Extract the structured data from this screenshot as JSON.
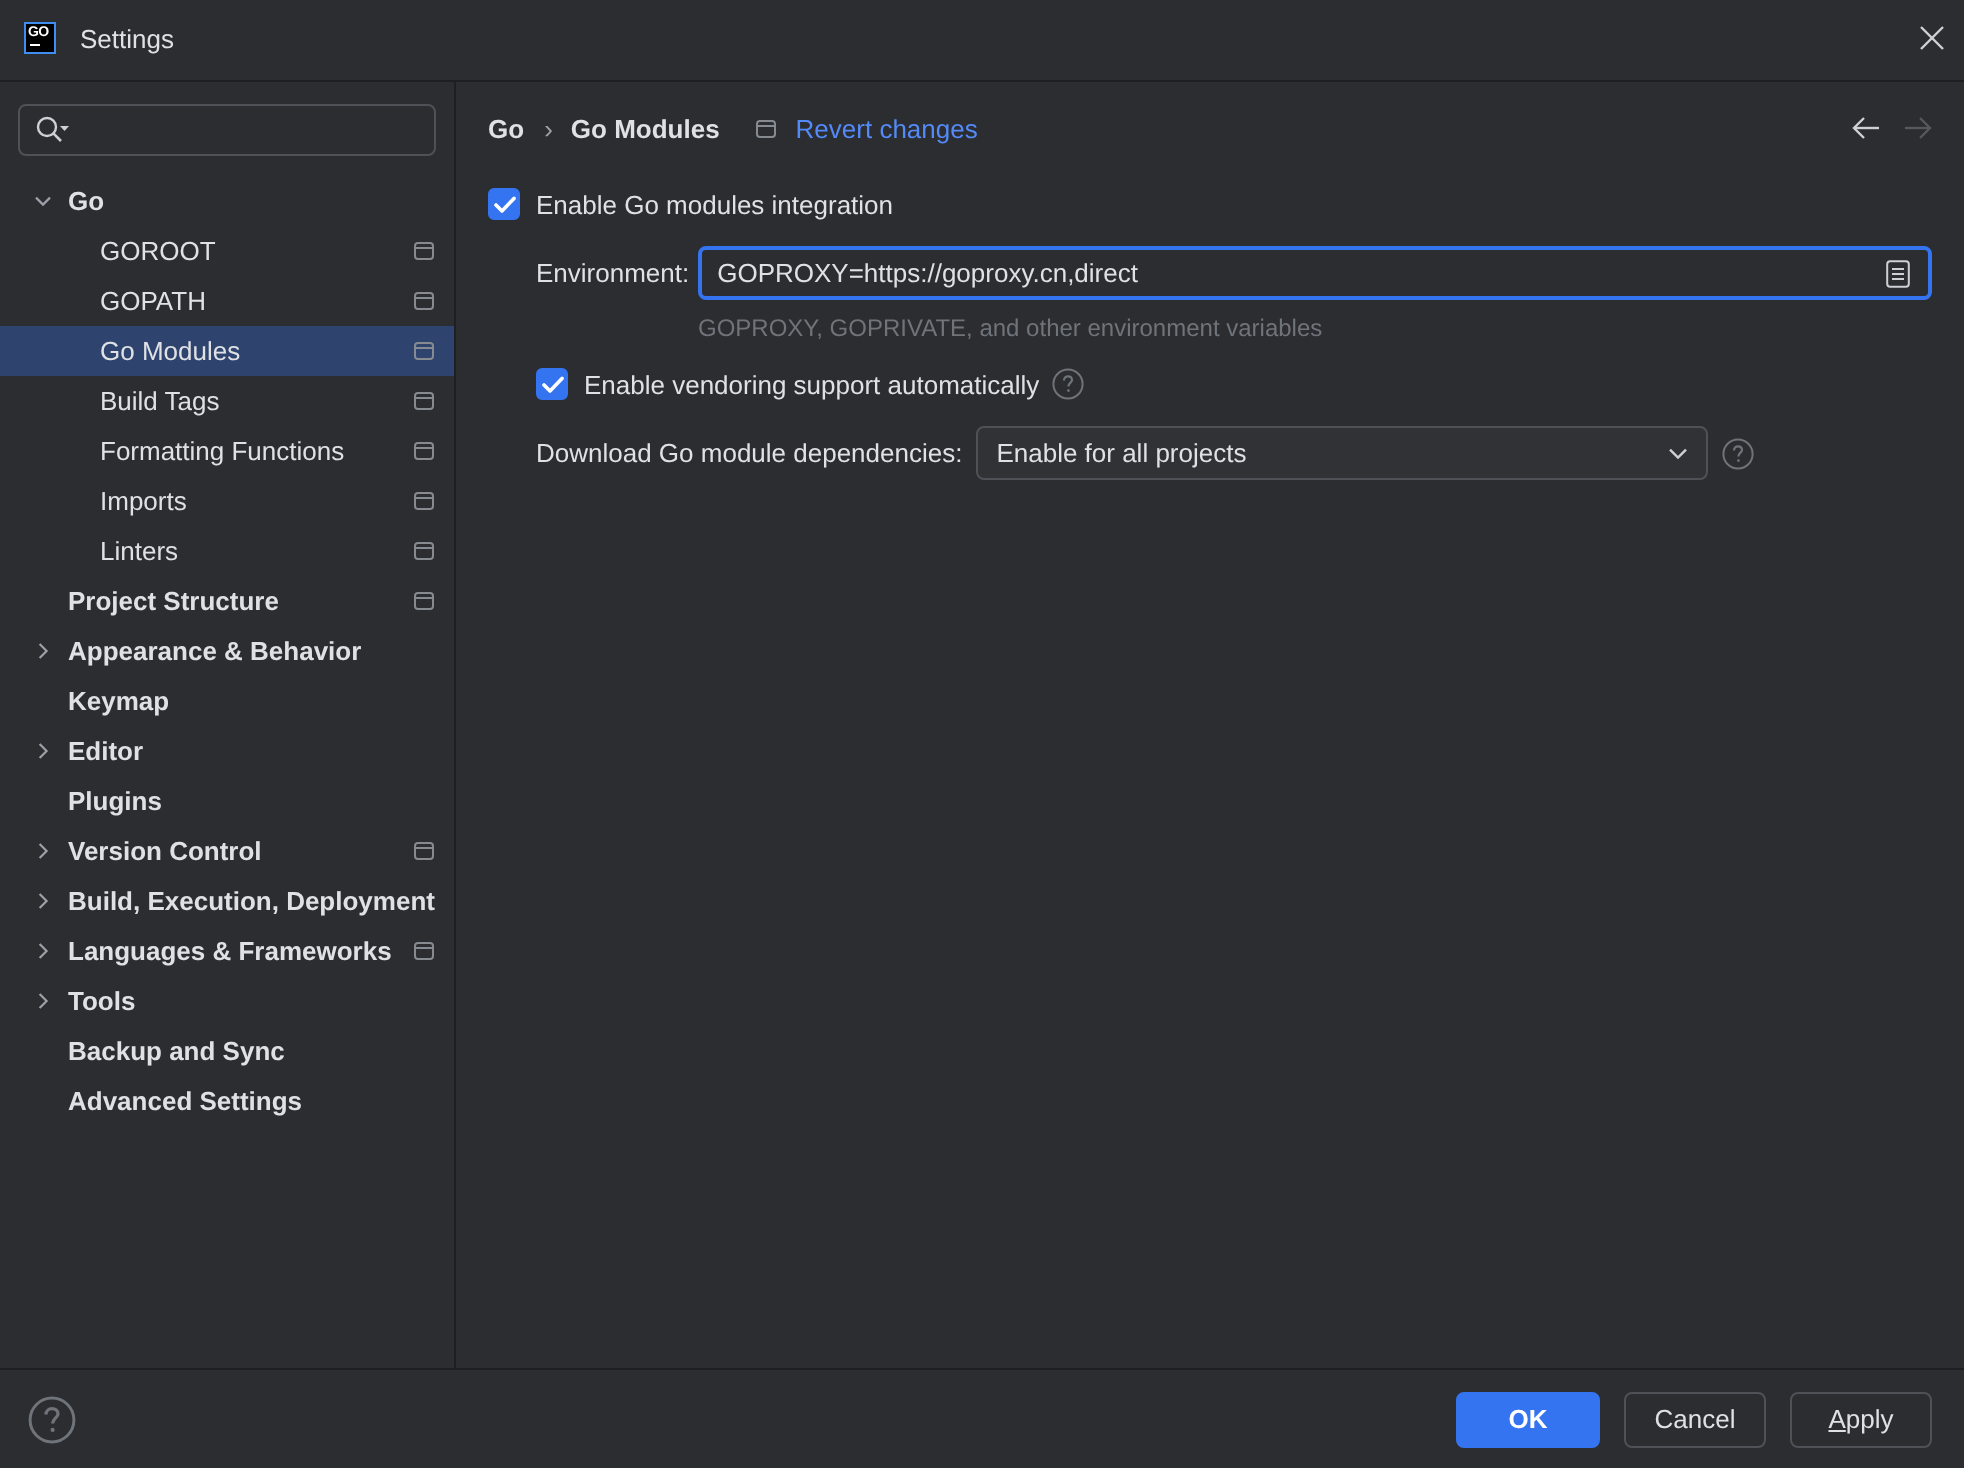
{
  "window": {
    "title": "Settings",
    "logo_text": "GO"
  },
  "sidebar": {
    "items": [
      {
        "label": "Go",
        "expanded": true,
        "selected": false,
        "per_project": false,
        "children": [
          {
            "label": "GOROOT",
            "selected": false,
            "per_project": true
          },
          {
            "label": "GOPATH",
            "selected": false,
            "per_project": true
          },
          {
            "label": "Go Modules",
            "selected": true,
            "per_project": true
          },
          {
            "label": "Build Tags",
            "selected": false,
            "per_project": true
          },
          {
            "label": "Formatting Functions",
            "selected": false,
            "per_project": true
          },
          {
            "label": "Imports",
            "selected": false,
            "per_project": true
          },
          {
            "label": "Linters",
            "selected": false,
            "per_project": true
          }
        ]
      },
      {
        "label": "Project Structure",
        "selected": false,
        "per_project": true
      },
      {
        "label": "Appearance & Behavior",
        "expanded": false,
        "selected": false,
        "per_project": false
      },
      {
        "label": "Keymap",
        "selected": false,
        "per_project": false
      },
      {
        "label": "Editor",
        "expanded": false,
        "selected": false,
        "per_project": false
      },
      {
        "label": "Plugins",
        "selected": false,
        "per_project": false
      },
      {
        "label": "Version Control",
        "expanded": false,
        "selected": false,
        "per_project": true
      },
      {
        "label": "Build, Execution, Deployment",
        "expanded": false,
        "selected": false,
        "per_project": false
      },
      {
        "label": "Languages & Frameworks",
        "expanded": false,
        "selected": false,
        "per_project": true
      },
      {
        "label": "Tools",
        "expanded": false,
        "selected": false,
        "per_project": false
      },
      {
        "label": "Backup and Sync",
        "selected": false,
        "per_project": false
      },
      {
        "label": "Advanced Settings",
        "selected": false,
        "per_project": false
      }
    ]
  },
  "breadcrumb": {
    "items": [
      "Go",
      "Go Modules"
    ],
    "separator": "›",
    "per_project": true,
    "revert_link": "Revert changes"
  },
  "navigation": {
    "back": {
      "disabled": false
    },
    "forward": {
      "disabled": true
    }
  },
  "settings": {
    "modules_integration": {
      "label": "Enable Go modules integration",
      "checked": true
    },
    "environment": {
      "label": "Environment:",
      "value": "GOPROXY=https://goproxy.cn,direct",
      "focused": true,
      "hint": "GOPROXY, GOPRIVATE, and other environment variables"
    },
    "vendoring": {
      "label": "Enable vendoring support automatically",
      "checked": true
    },
    "download": {
      "label": "Download Go module dependencies:",
      "value": "Enable for all projects"
    }
  },
  "buttons": [
    {
      "label": "OK",
      "primary": true,
      "mnemonic": false
    },
    {
      "label": "Cancel",
      "primary": false,
      "mnemonic": false
    },
    {
      "label": "Apply",
      "primary": false,
      "mnemonic": true
    }
  ]
}
